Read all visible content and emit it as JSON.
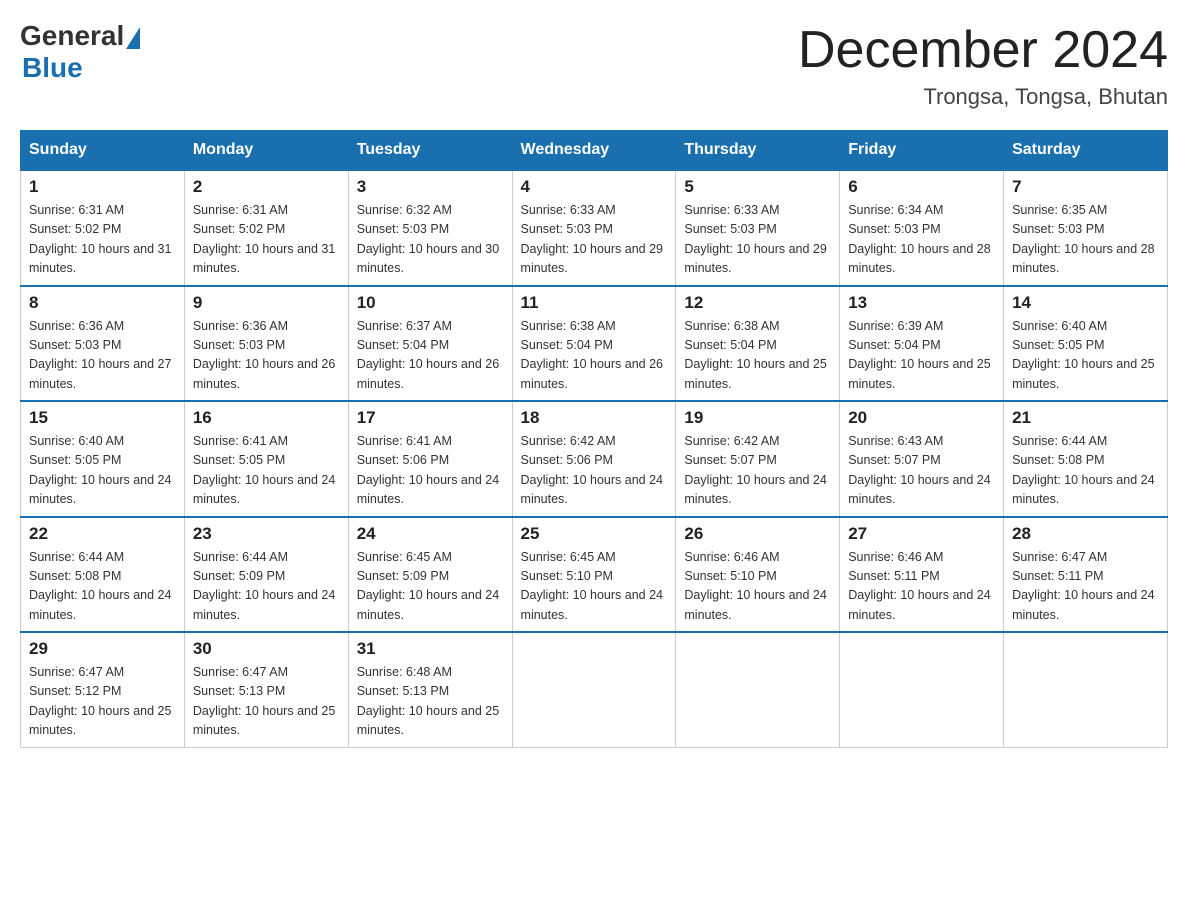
{
  "logo": {
    "general": "General",
    "blue": "Blue"
  },
  "title": "December 2024",
  "location": "Trongsa, Tongsa, Bhutan",
  "days_of_week": [
    "Sunday",
    "Monday",
    "Tuesday",
    "Wednesday",
    "Thursday",
    "Friday",
    "Saturday"
  ],
  "weeks": [
    [
      {
        "day": "1",
        "sunrise": "6:31 AM",
        "sunset": "5:02 PM",
        "daylight": "10 hours and 31 minutes."
      },
      {
        "day": "2",
        "sunrise": "6:31 AM",
        "sunset": "5:02 PM",
        "daylight": "10 hours and 31 minutes."
      },
      {
        "day": "3",
        "sunrise": "6:32 AM",
        "sunset": "5:03 PM",
        "daylight": "10 hours and 30 minutes."
      },
      {
        "day": "4",
        "sunrise": "6:33 AM",
        "sunset": "5:03 PM",
        "daylight": "10 hours and 29 minutes."
      },
      {
        "day": "5",
        "sunrise": "6:33 AM",
        "sunset": "5:03 PM",
        "daylight": "10 hours and 29 minutes."
      },
      {
        "day": "6",
        "sunrise": "6:34 AM",
        "sunset": "5:03 PM",
        "daylight": "10 hours and 28 minutes."
      },
      {
        "day": "7",
        "sunrise": "6:35 AM",
        "sunset": "5:03 PM",
        "daylight": "10 hours and 28 minutes."
      }
    ],
    [
      {
        "day": "8",
        "sunrise": "6:36 AM",
        "sunset": "5:03 PM",
        "daylight": "10 hours and 27 minutes."
      },
      {
        "day": "9",
        "sunrise": "6:36 AM",
        "sunset": "5:03 PM",
        "daylight": "10 hours and 26 minutes."
      },
      {
        "day": "10",
        "sunrise": "6:37 AM",
        "sunset": "5:04 PM",
        "daylight": "10 hours and 26 minutes."
      },
      {
        "day": "11",
        "sunrise": "6:38 AM",
        "sunset": "5:04 PM",
        "daylight": "10 hours and 26 minutes."
      },
      {
        "day": "12",
        "sunrise": "6:38 AM",
        "sunset": "5:04 PM",
        "daylight": "10 hours and 25 minutes."
      },
      {
        "day": "13",
        "sunrise": "6:39 AM",
        "sunset": "5:04 PM",
        "daylight": "10 hours and 25 minutes."
      },
      {
        "day": "14",
        "sunrise": "6:40 AM",
        "sunset": "5:05 PM",
        "daylight": "10 hours and 25 minutes."
      }
    ],
    [
      {
        "day": "15",
        "sunrise": "6:40 AM",
        "sunset": "5:05 PM",
        "daylight": "10 hours and 24 minutes."
      },
      {
        "day": "16",
        "sunrise": "6:41 AM",
        "sunset": "5:05 PM",
        "daylight": "10 hours and 24 minutes."
      },
      {
        "day": "17",
        "sunrise": "6:41 AM",
        "sunset": "5:06 PM",
        "daylight": "10 hours and 24 minutes."
      },
      {
        "day": "18",
        "sunrise": "6:42 AM",
        "sunset": "5:06 PM",
        "daylight": "10 hours and 24 minutes."
      },
      {
        "day": "19",
        "sunrise": "6:42 AM",
        "sunset": "5:07 PM",
        "daylight": "10 hours and 24 minutes."
      },
      {
        "day": "20",
        "sunrise": "6:43 AM",
        "sunset": "5:07 PM",
        "daylight": "10 hours and 24 minutes."
      },
      {
        "day": "21",
        "sunrise": "6:44 AM",
        "sunset": "5:08 PM",
        "daylight": "10 hours and 24 minutes."
      }
    ],
    [
      {
        "day": "22",
        "sunrise": "6:44 AM",
        "sunset": "5:08 PM",
        "daylight": "10 hours and 24 minutes."
      },
      {
        "day": "23",
        "sunrise": "6:44 AM",
        "sunset": "5:09 PM",
        "daylight": "10 hours and 24 minutes."
      },
      {
        "day": "24",
        "sunrise": "6:45 AM",
        "sunset": "5:09 PM",
        "daylight": "10 hours and 24 minutes."
      },
      {
        "day": "25",
        "sunrise": "6:45 AM",
        "sunset": "5:10 PM",
        "daylight": "10 hours and 24 minutes."
      },
      {
        "day": "26",
        "sunrise": "6:46 AM",
        "sunset": "5:10 PM",
        "daylight": "10 hours and 24 minutes."
      },
      {
        "day": "27",
        "sunrise": "6:46 AM",
        "sunset": "5:11 PM",
        "daylight": "10 hours and 24 minutes."
      },
      {
        "day": "28",
        "sunrise": "6:47 AM",
        "sunset": "5:11 PM",
        "daylight": "10 hours and 24 minutes."
      }
    ],
    [
      {
        "day": "29",
        "sunrise": "6:47 AM",
        "sunset": "5:12 PM",
        "daylight": "10 hours and 25 minutes."
      },
      {
        "day": "30",
        "sunrise": "6:47 AM",
        "sunset": "5:13 PM",
        "daylight": "10 hours and 25 minutes."
      },
      {
        "day": "31",
        "sunrise": "6:48 AM",
        "sunset": "5:13 PM",
        "daylight": "10 hours and 25 minutes."
      },
      null,
      null,
      null,
      null
    ]
  ]
}
